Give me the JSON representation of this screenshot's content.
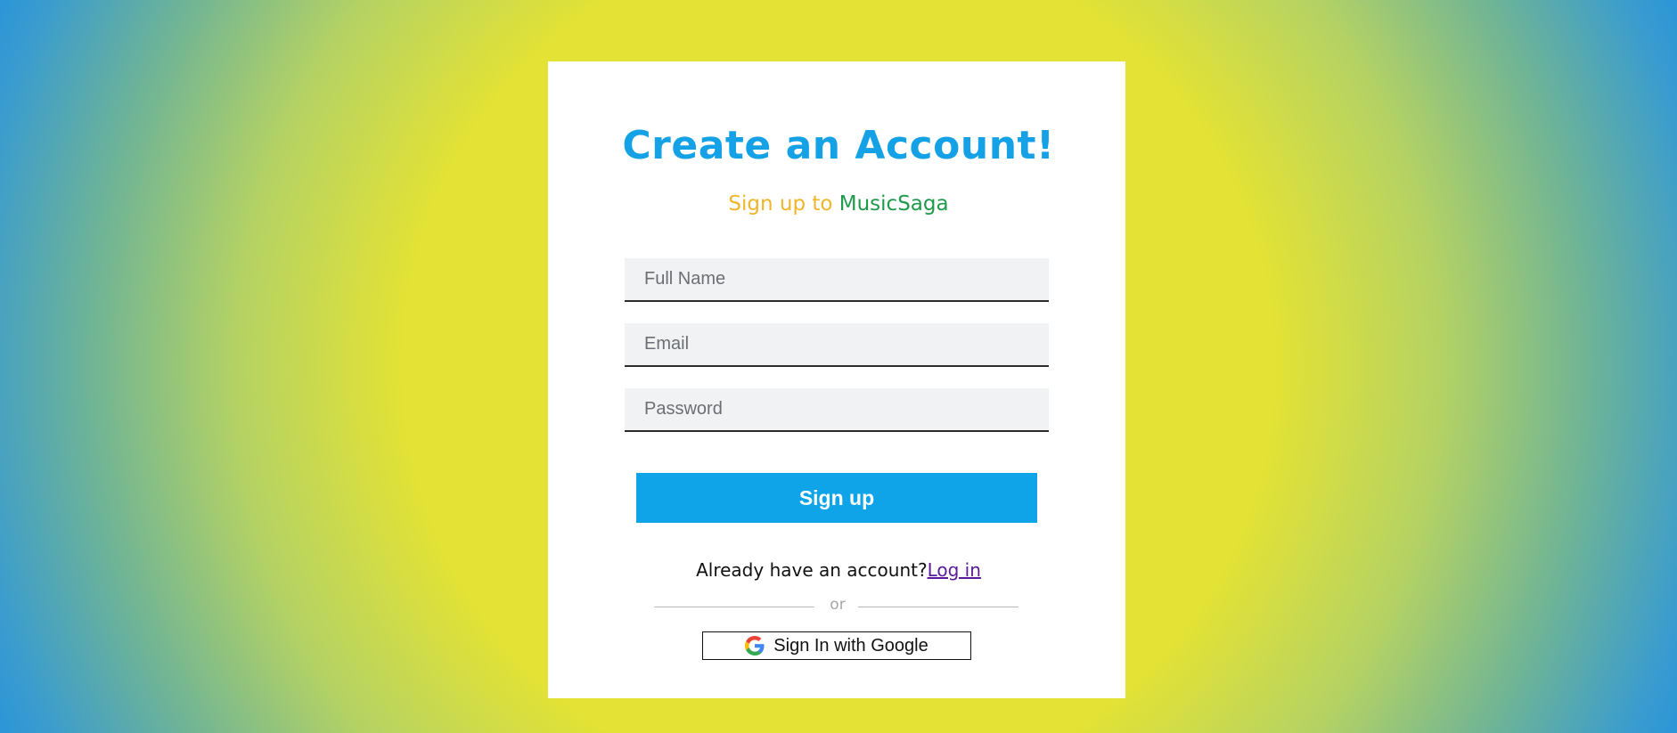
{
  "heading": {
    "title": "Create an Account!",
    "subtitle_lead": "Sign up to",
    "subtitle_brand": "MusicSaga"
  },
  "form": {
    "full_name": {
      "placeholder": "Full Name",
      "value": ""
    },
    "email": {
      "placeholder": "Email",
      "value": ""
    },
    "password": {
      "placeholder": "Password",
      "value": ""
    },
    "submit_label": "Sign up"
  },
  "login_prompt": {
    "text": "Already have an account?",
    "link_label": "Log in"
  },
  "divider_text": "or",
  "google_button": {
    "label": "Sign In with Google",
    "icon": "google-g-icon"
  },
  "colors": {
    "title": "#14a1e5",
    "subtitle_lead": "#f0b62a",
    "brand": "#1f9a4a",
    "button": "#0fa3e8",
    "link": "#5a189a",
    "background_center": "#e6e234",
    "background_edge": "#1e8fe0"
  }
}
